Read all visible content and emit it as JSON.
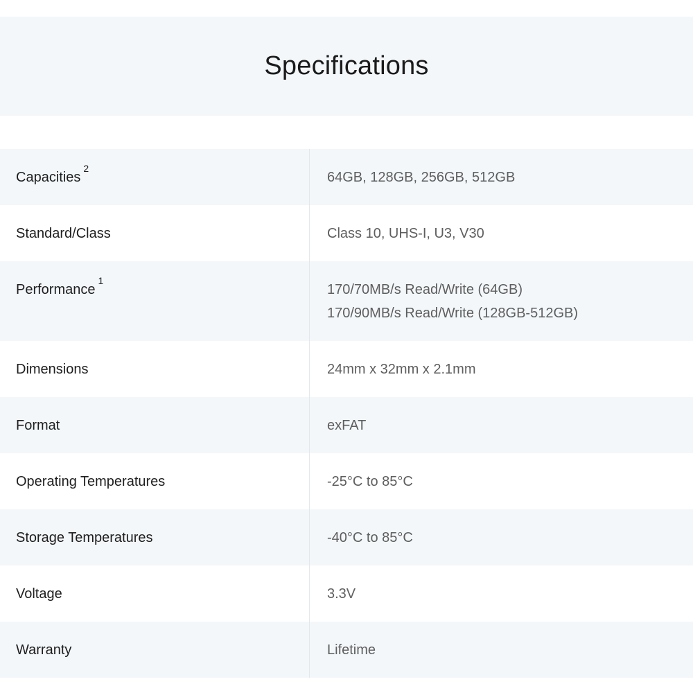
{
  "title": "Specifications",
  "rows": [
    {
      "label": "Capacities",
      "sup": "2",
      "values": [
        "64GB, 128GB, 256GB, 512GB"
      ]
    },
    {
      "label": "Standard/Class",
      "sup": "",
      "values": [
        "Class 10, UHS-I, U3, V30"
      ]
    },
    {
      "label": "Performance",
      "sup": "1",
      "values": [
        "170/70MB/s Read/Write (64GB)",
        "170/90MB/s Read/Write (128GB-512GB)"
      ]
    },
    {
      "label": "Dimensions",
      "sup": "",
      "values": [
        "24mm x 32mm x 2.1mm"
      ]
    },
    {
      "label": "Format",
      "sup": "",
      "values": [
        "exFAT"
      ]
    },
    {
      "label": "Operating Temperatures",
      "sup": "",
      "values": [
        "-25°C to 85°C"
      ]
    },
    {
      "label": "Storage Temperatures",
      "sup": "",
      "values": [
        "-40°C to 85°C"
      ]
    },
    {
      "label": "Voltage",
      "sup": "",
      "values": [
        "3.3V"
      ]
    },
    {
      "label": "Warranty",
      "sup": "",
      "values": [
        "Lifetime"
      ]
    }
  ]
}
